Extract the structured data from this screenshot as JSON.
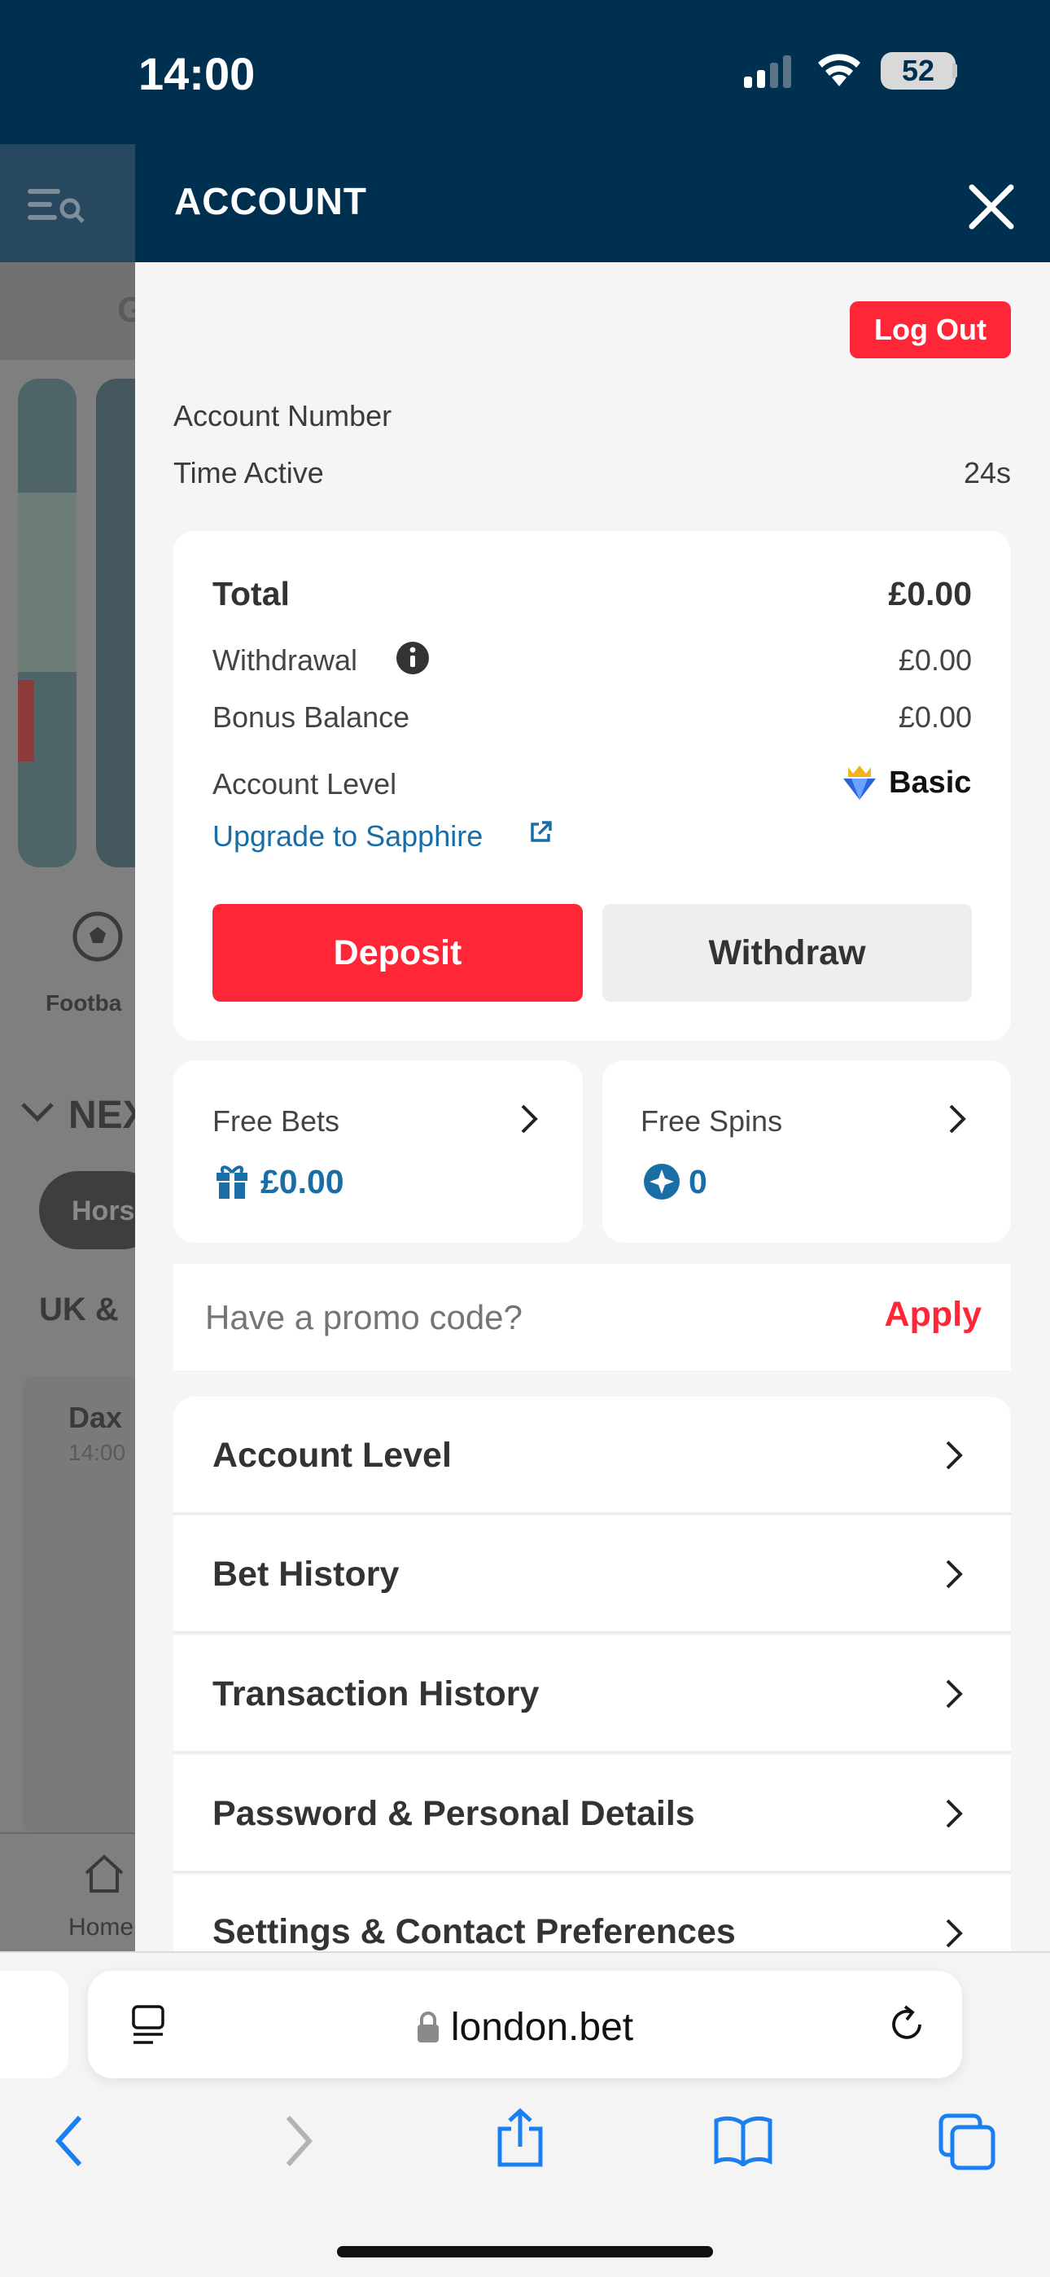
{
  "status_bar": {
    "time": "14:00",
    "battery": "52"
  },
  "background_page": {
    "brand_letter": "G",
    "sport_label": "Footba",
    "section_title": "NEX",
    "pill_label": "Hors",
    "region_title": "UK &",
    "race_name": "Dax",
    "race_time": "14:00",
    "tab_home": "Home"
  },
  "panel": {
    "title": "ACCOUNT",
    "logout_label": "Log Out",
    "account_number_label": "Account Number",
    "time_active_label": "Time Active",
    "time_active_value": "24s"
  },
  "balance": {
    "total_label": "Total",
    "total_value": "£0.00",
    "withdrawal_label": "Withdrawal",
    "withdrawal_value": "£0.00",
    "bonus_label": "Bonus Balance",
    "bonus_value": "£0.00",
    "level_label": "Account Level",
    "level_value": "Basic",
    "upgrade_link": "Upgrade to Sapphire",
    "deposit_label": "Deposit",
    "withdraw_label": "Withdraw"
  },
  "free_bets": {
    "label": "Free Bets",
    "value": "£0.00"
  },
  "free_spins": {
    "label": "Free Spins",
    "value": "0"
  },
  "promo": {
    "placeholder": "Have a promo code?",
    "apply_label": "Apply"
  },
  "menu": [
    {
      "label": "Account Level"
    },
    {
      "label": "Bet History"
    },
    {
      "label": "Transaction History"
    },
    {
      "label": "Password & Personal Details"
    },
    {
      "label": "Settings & Contact Preferences"
    }
  ],
  "browser": {
    "url": "london.bet"
  },
  "colors": {
    "navy": "#00304f",
    "red": "#ff2638",
    "link_blue": "#1a6ea6"
  }
}
